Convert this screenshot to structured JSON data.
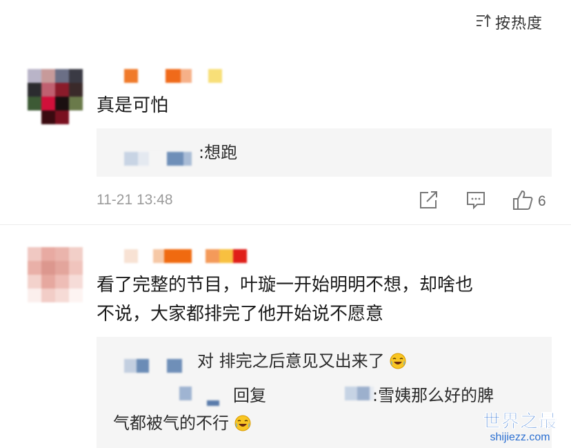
{
  "header": {
    "sort_label": "按热度"
  },
  "comments": [
    {
      "text": "真是可怕",
      "replies": [
        {
          "text": ":想跑"
        }
      ],
      "time": "11-21 13:48",
      "likes": "6"
    },
    {
      "text_line1": "看了完整的节目，叶璇一开始明明不想，却啥也",
      "text_line2": "不说，大家都排完了他开始说不愿意",
      "replies": [
        {
          "text": "对 排完之后意见又出来了"
        },
        {
          "text_reply_word": "回复",
          "text_tail": ":雪姨那么好的脾",
          "text_line2": "气都被气的不行"
        }
      ]
    }
  ],
  "watermark": {
    "title": "世界之最",
    "url": "shijiezz.com"
  },
  "colors": {
    "accent": "#2b6fd1",
    "meta": "#9a9a9a",
    "reply_bg": "#f5f5f5"
  }
}
